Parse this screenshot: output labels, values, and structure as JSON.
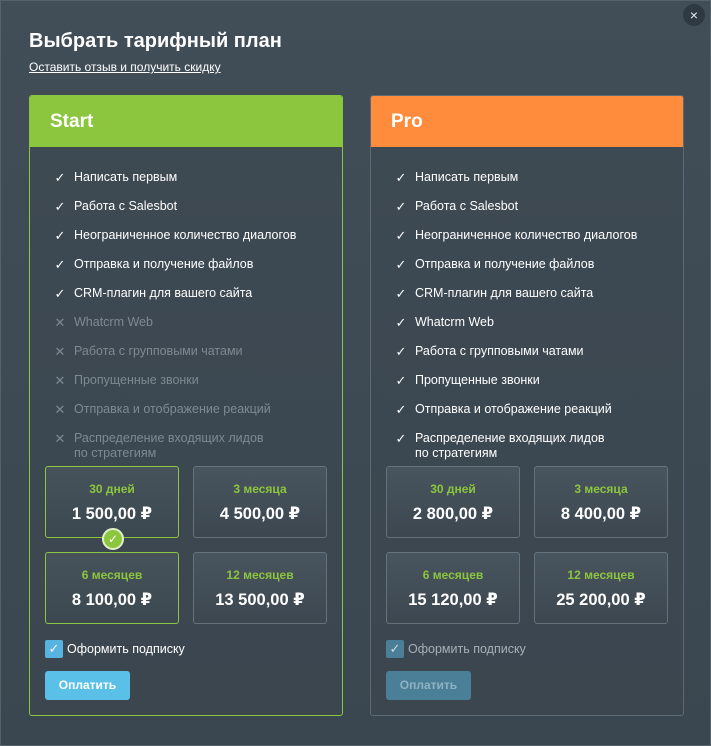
{
  "title": "Выбрать тарифный план",
  "feedback_link": "Оставить отзыв и получить скидку",
  "close_icon": "×",
  "colors": {
    "start": "#8cc63f",
    "pro": "#ff8b3d",
    "accent": "#5bc0e8"
  },
  "start": {
    "name": "Start",
    "features": [
      {
        "label": "Написать первым",
        "enabled": true
      },
      {
        "label": "Работа с Salesbot",
        "enabled": true
      },
      {
        "label": "Неограниченное количество диалогов",
        "enabled": true
      },
      {
        "label": "Отправка и получение файлов",
        "enabled": true
      },
      {
        "label": "CRM-плагин для вашего сайта",
        "enabled": true
      },
      {
        "label": "Whatcrm Web",
        "enabled": false
      },
      {
        "label": "Работа с групповыми чатами",
        "enabled": false
      },
      {
        "label": "Пропущенные звонки",
        "enabled": false
      },
      {
        "label": "Отправка и отображение реакций",
        "enabled": false
      },
      {
        "label": "Распределение входящих лидов",
        "label2": "по стратегиям",
        "enabled": false
      }
    ],
    "prices": [
      {
        "duration": "30 дней",
        "amount": "1 500,00 ₽",
        "selected": true
      },
      {
        "duration": "3 месяца",
        "amount": "4 500,00 ₽",
        "selected": false
      },
      {
        "duration": "6 месяцев",
        "amount": "8 100,00 ₽",
        "selected": false
      },
      {
        "duration": "12 месяцев",
        "amount": "13 500,00 ₽",
        "selected": false
      }
    ],
    "subscribe_label": "Оформить подписку",
    "subscribe_checked": true,
    "pay_label": "Оплатить"
  },
  "pro": {
    "name": "Pro",
    "features": [
      {
        "label": "Написать первым",
        "enabled": true
      },
      {
        "label": "Работа с Salesbot",
        "enabled": true
      },
      {
        "label": "Неограниченное количество диалогов",
        "enabled": true
      },
      {
        "label": "Отправка и получение файлов",
        "enabled": true
      },
      {
        "label": "CRM-плагин для вашего сайта",
        "enabled": true
      },
      {
        "label": "Whatcrm Web",
        "enabled": true
      },
      {
        "label": "Работа с групповыми чатами",
        "enabled": true
      },
      {
        "label": "Пропущенные звонки",
        "enabled": true
      },
      {
        "label": "Отправка и отображение реакций",
        "enabled": true
      },
      {
        "label": "Распределение входящих лидов",
        "label2": "по стратегиям",
        "enabled": true
      }
    ],
    "prices": [
      {
        "duration": "30 дней",
        "amount": "2 800,00 ₽",
        "selected": false
      },
      {
        "duration": "3 месяца",
        "amount": "8 400,00 ₽",
        "selected": false
      },
      {
        "duration": "6 месяцев",
        "amount": "15 120,00 ₽",
        "selected": false
      },
      {
        "duration": "12 месяцев",
        "amount": "25 200,00 ₽",
        "selected": false
      }
    ],
    "subscribe_label": "Оформить подписку",
    "subscribe_checked": true,
    "pay_label": "Оплатить"
  }
}
